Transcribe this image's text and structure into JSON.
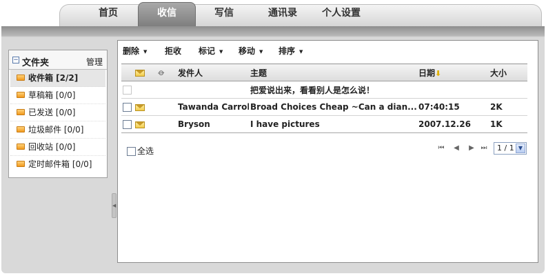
{
  "tabs": [
    {
      "label": "首页",
      "active": false
    },
    {
      "label": "收信",
      "active": true
    },
    {
      "label": "写信",
      "active": false
    },
    {
      "label": "通讯录",
      "active": false
    },
    {
      "label": "个人设置",
      "active": false
    }
  ],
  "sidebar": {
    "title": "文件夹",
    "collapse_glyph": "−",
    "manage_label": "管理",
    "folders": [
      {
        "label": "收件箱 [2/2]",
        "selected": true
      },
      {
        "label": "草稿箱 [0/0]",
        "selected": false
      },
      {
        "label": "已发送 [0/0]",
        "selected": false
      },
      {
        "label": "垃圾邮件 [0/0]",
        "selected": false
      },
      {
        "label": "回收站 [0/0]",
        "selected": false
      },
      {
        "label": "定时邮件箱 [0/0]",
        "selected": false
      }
    ]
  },
  "toolbar": {
    "delete_label": "删除",
    "reject_label": "拒收",
    "mark_label": "标记",
    "move_label": "移动",
    "sort_label": "排序"
  },
  "table": {
    "headers": {
      "sender": "发件人",
      "subject": "主题",
      "date": "日期",
      "size": "大小"
    },
    "rows": [
      {
        "sender": "",
        "subject": "把爱说出来，看看别人是怎么说！",
        "date": "",
        "size": "",
        "has_envelope": false
      },
      {
        "sender": "Tawanda Carroll",
        "subject": "Broad Choices Cheap ~Can a dian......",
        "date": "07:40:15",
        "size": "2K",
        "has_envelope": true
      },
      {
        "sender": "Bryson",
        "subject": "I have pictures",
        "date": "2007.12.26",
        "size": "1K",
        "has_envelope": true
      }
    ]
  },
  "footer": {
    "select_all_label": "全选",
    "page_value": "1 / 1"
  },
  "colors": {
    "frame_gray": "#d9d9d9",
    "active_tab": "#8a8a8a",
    "folder_icon": "#f29a1f",
    "sort_arrow": "#e0b000"
  },
  "icons": {
    "collapse": "minus-box-icon",
    "folder": "folder-icon",
    "envelope": "envelope-icon",
    "attachment": "paperclip-icon",
    "sort": "sort-down-arrow-icon",
    "pager": [
      "first-page-icon",
      "prev-page-icon",
      "next-page-icon",
      "last-page-icon"
    ]
  }
}
